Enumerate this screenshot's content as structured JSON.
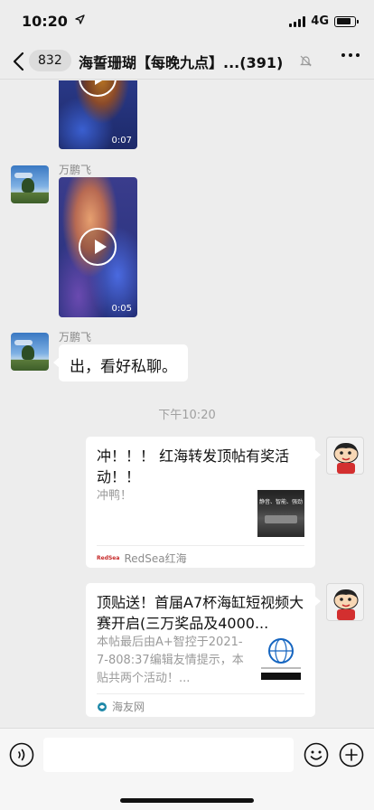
{
  "status_bar": {
    "time": "10:20",
    "network": "4G"
  },
  "nav": {
    "back_badge": "832",
    "title": "海誓珊瑚【每晚九点】...",
    "member_count": "(391)"
  },
  "messages": {
    "video1_duration": "0:07",
    "sender1": "万鹏飞",
    "video2_duration": "0:05",
    "sender2": "万鹏飞",
    "text_message": "出，看好私聊。",
    "timestamp": "下午10:20"
  },
  "card1": {
    "title": "冲！！！ 红海转发顶帖有奖活动！！",
    "description": "冲鸭！",
    "source": "RedSea红海",
    "source_logo_text": "RedSea",
    "thumbnail_text": "静音、智能、强劲"
  },
  "card2": {
    "title": "顶贴送！首届A7杯海缸短视频大赛开启(三万奖品及4000...",
    "description": "本帖最后由A+智控于2021-7-808:37编辑友情提示，本贴共两个活动！...",
    "source": "海友网"
  },
  "colors": {
    "background": "#ededed",
    "bubble": "#ffffff",
    "secondary_text": "#8c8c8c"
  }
}
